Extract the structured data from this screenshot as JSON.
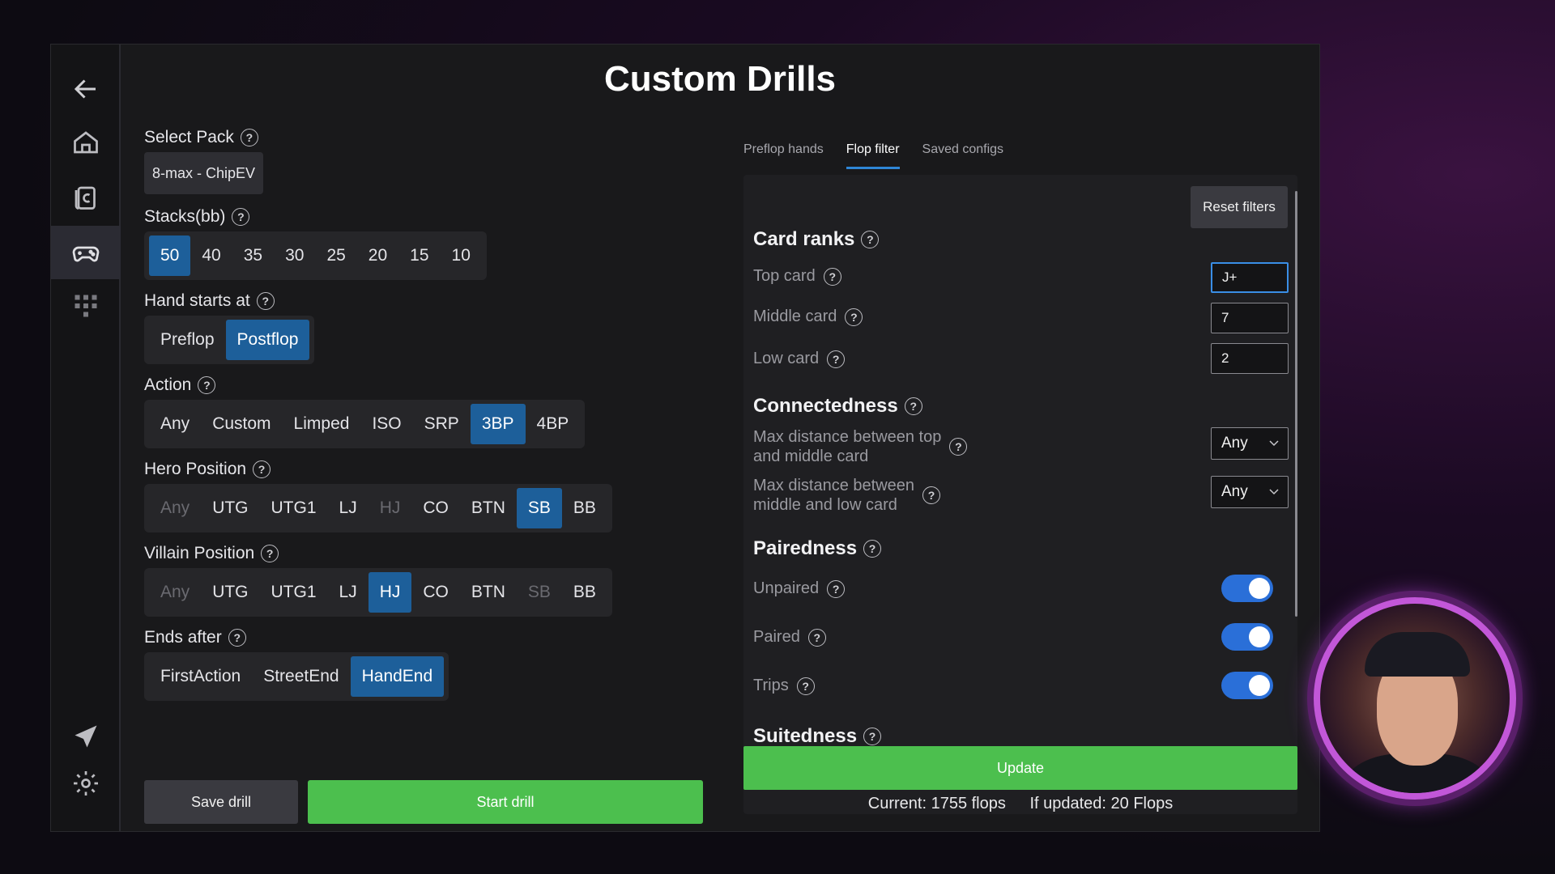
{
  "title": "Custom Drills",
  "sidebar": {
    "items": [
      {
        "icon": "back-arrow-icon"
      },
      {
        "icon": "home-icon"
      },
      {
        "icon": "cards-icon"
      },
      {
        "icon": "gamepad-icon"
      },
      {
        "icon": "grid-icon"
      },
      {
        "icon": "send-icon"
      },
      {
        "icon": "settings-icon"
      }
    ]
  },
  "left": {
    "pack": {
      "label": "Select Pack",
      "value": "8-max - ChipEV"
    },
    "stacks": {
      "label": "Stacks(bb)",
      "options": [
        "50",
        "40",
        "35",
        "30",
        "25",
        "20",
        "15",
        "10"
      ],
      "selected": "50"
    },
    "hand_starts": {
      "label": "Hand starts at",
      "options": [
        "Preflop",
        "Postflop"
      ],
      "selected": "Postflop"
    },
    "action": {
      "label": "Action",
      "options": [
        "Any",
        "Custom",
        "Limped",
        "ISO",
        "SRP",
        "3BP",
        "4BP"
      ],
      "selected": "3BP"
    },
    "hero": {
      "label": "Hero Position",
      "options": [
        "Any",
        "UTG",
        "UTG1",
        "LJ",
        "HJ",
        "CO",
        "BTN",
        "SB",
        "BB"
      ],
      "selected": "SB",
      "disabled": [
        "Any",
        "HJ"
      ]
    },
    "villain": {
      "label": "Villain Position",
      "options": [
        "Any",
        "UTG",
        "UTG1",
        "LJ",
        "HJ",
        "CO",
        "BTN",
        "SB",
        "BB"
      ],
      "selected": "HJ",
      "disabled": [
        "Any",
        "SB"
      ]
    },
    "ends": {
      "label": "Ends after",
      "options": [
        "FirstAction",
        "StreetEnd",
        "HandEnd"
      ],
      "selected": "HandEnd"
    },
    "save_label": "Save drill",
    "start_label": "Start drill"
  },
  "tabs": [
    {
      "label": "Preflop hands",
      "active": false
    },
    {
      "label": "Flop filter",
      "active": true
    },
    {
      "label": "Saved configs",
      "active": false
    }
  ],
  "filter": {
    "reset_label": "Reset filters",
    "card_ranks": {
      "title": "Card ranks",
      "top": {
        "label": "Top card",
        "value": "J+"
      },
      "middle": {
        "label": "Middle card",
        "value": "7"
      },
      "low": {
        "label": "Low card",
        "value": "2"
      }
    },
    "connectedness": {
      "title": "Connectedness",
      "top_mid": {
        "label_line1": "Max distance between top",
        "label_line2": "and middle card",
        "value": "Any"
      },
      "mid_low": {
        "label_line1": "Max distance between",
        "label_line2": "middle and low card",
        "value": "Any"
      }
    },
    "pairedness": {
      "title": "Pairedness",
      "unpaired": {
        "label": "Unpaired",
        "on": true
      },
      "paired": {
        "label": "Paired",
        "on": true
      },
      "trips": {
        "label": "Trips",
        "on": true
      }
    },
    "suitedness": {
      "title": "Suitedness"
    },
    "update_label": "Update",
    "current": "Current: 1755 flops",
    "if_updated": "If updated: 20 Flops"
  },
  "help_glyph": "?",
  "colors": {
    "accent": "#1d5f9a",
    "green": "#4cbf4e",
    "toggle": "#2a6fd8"
  }
}
